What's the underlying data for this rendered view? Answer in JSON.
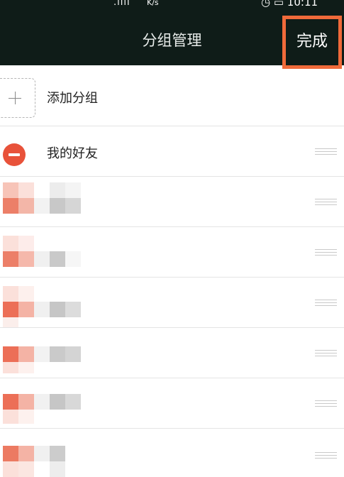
{
  "status_bar": {
    "signal": ".ııll",
    "speed_unit": "K/s",
    "clock": "10:11"
  },
  "header": {
    "title": "分组管理",
    "done_label": "完成"
  },
  "colors": {
    "header_bg": "#0f1c18",
    "highlight_border": "#f06a3a",
    "delete_red": "#e8523a"
  },
  "list": {
    "add_group_label": "添加分组",
    "groups": [
      {
        "name": "我的好友",
        "deletable": true
      },
      {
        "name": "",
        "blurred": true
      },
      {
        "name": "",
        "blurred": true
      },
      {
        "name": "",
        "blurred": true
      },
      {
        "name": "",
        "blurred": true
      },
      {
        "name": "",
        "blurred": true
      },
      {
        "name": "",
        "blurred": true
      }
    ]
  },
  "icons": {
    "add": "plus-icon",
    "delete": "minus-circle-icon",
    "drag": "drag-handle-icon"
  }
}
